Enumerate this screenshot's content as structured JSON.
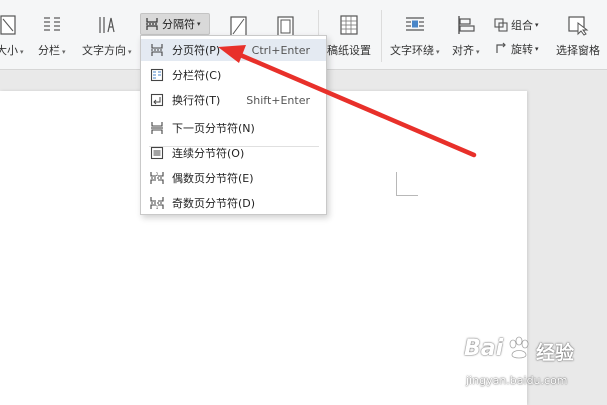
{
  "ribbon": {
    "size_label": "大小",
    "columns_label": "分栏",
    "text_direction_label": "文字方向",
    "breaks_label": "分隔符",
    "manuscript_label": "稿纸设置",
    "text_wrap_label": "文字环绕",
    "align_label": "对齐",
    "group_label": "组合",
    "rotate_label": "旋转",
    "selection_pane_label": "选择窗格"
  },
  "breaks_menu": {
    "items": [
      {
        "label": "分页符(P)",
        "shortcut": "Ctrl+Enter",
        "icon": "page-break-icon"
      },
      {
        "label": "分栏符(C)",
        "shortcut": "",
        "icon": "column-break-icon"
      },
      {
        "label": "换行符(T)",
        "shortcut": "Shift+Enter",
        "icon": "line-break-icon"
      },
      {
        "label": "下一页分节符(N)",
        "shortcut": "",
        "icon": "next-page-section-icon"
      },
      {
        "label": "连续分节符(O)",
        "shortcut": "",
        "icon": "continuous-section-icon"
      },
      {
        "label": "偶数页分节符(E)",
        "shortcut": "",
        "icon": "even-page-section-icon"
      },
      {
        "label": "奇数页分节符(D)",
        "shortcut": "",
        "icon": "odd-page-section-icon"
      }
    ]
  },
  "watermark": {
    "brand": "Bai",
    "brand_suffix": "经验",
    "url": "jingyan.baidu.com"
  },
  "colors": {
    "arrow": "#e8302a",
    "menu_highlight": "#e4eaf2"
  }
}
